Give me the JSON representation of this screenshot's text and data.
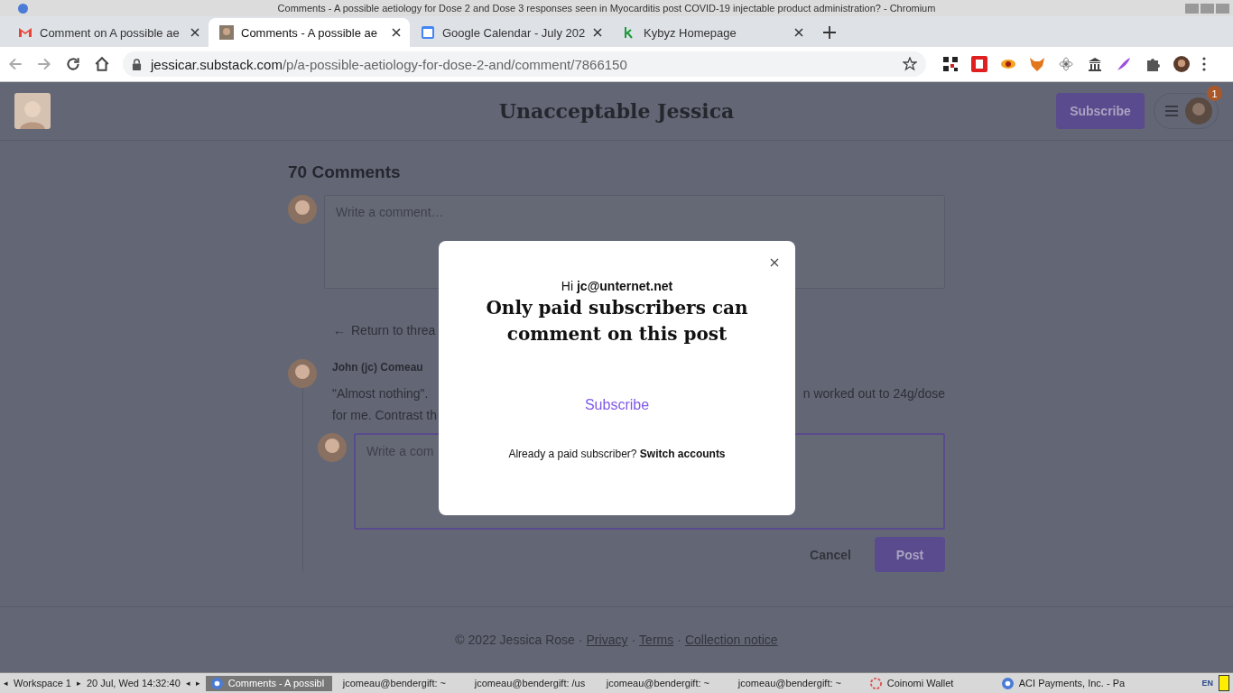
{
  "window": {
    "title": "Comments - A possible aetiology for Dose 2 and Dose 3 responses seen in Myocarditis post COVID-19 injectable product administration? - Chromium"
  },
  "tabs": [
    {
      "label": "Comment on A possible ae",
      "selected": false
    },
    {
      "label": "Comments - A possible ae",
      "selected": true
    },
    {
      "label": "Google Calendar - July 202",
      "selected": false
    },
    {
      "label": "Kybyz Homepage",
      "selected": false
    }
  ],
  "address": {
    "domain": "jessicar.substack.com",
    "path": "/p/a-possible-aetiology-for-dose-2-and/comment/7866150"
  },
  "site": {
    "title": "Unacceptable Jessica",
    "subscribe": "Subscribe",
    "badge": "1"
  },
  "comments": {
    "heading": "70 Comments",
    "placeholder": "Write a comment…",
    "return_arrow": "←",
    "return_link": "Return to threa",
    "comment": {
      "author": "John (jc) Comeau",
      "lines": [
        {
          "left": "\"Almost nothing\".",
          "right": "n worked out to 24g/dose"
        },
        {
          "left": "for me. Contrast th"
        }
      ]
    },
    "reply_placeholder": "Write a com",
    "cancel": "Cancel",
    "post": "Post"
  },
  "footer": {
    "copyright": "© 2022 Jessica Rose",
    "separator": "·",
    "links": [
      "Privacy",
      "Terms",
      "Collection notice"
    ]
  },
  "modal": {
    "greeting": "Hi",
    "email": "jc@unternet.net",
    "heading": "Only paid subscribers can comment on this post",
    "subscribe": "Subscribe",
    "already": "Already a paid subscriber?",
    "switch": "Switch accounts"
  },
  "taskbar": {
    "prev": "◂",
    "next": "▸",
    "workspace": "Workspace 1",
    "clock": "20 Jul, Wed 14:32:40",
    "tasks": [
      {
        "label": "Comments - A possibl",
        "selected": true
      },
      {
        "label": "jcomeau@bendergift: ~",
        "selected": false
      },
      {
        "label": "jcomeau@bendergift: /us",
        "selected": false
      },
      {
        "label": "jcomeau@bendergift: ~",
        "selected": false
      },
      {
        "label": "jcomeau@bendergift: ~",
        "selected": false
      },
      {
        "label": "Coinomi Wallet",
        "selected": false
      },
      {
        "label": "ACI Payments, Inc. - Pa",
        "selected": false
      }
    ],
    "lang": "EN"
  }
}
